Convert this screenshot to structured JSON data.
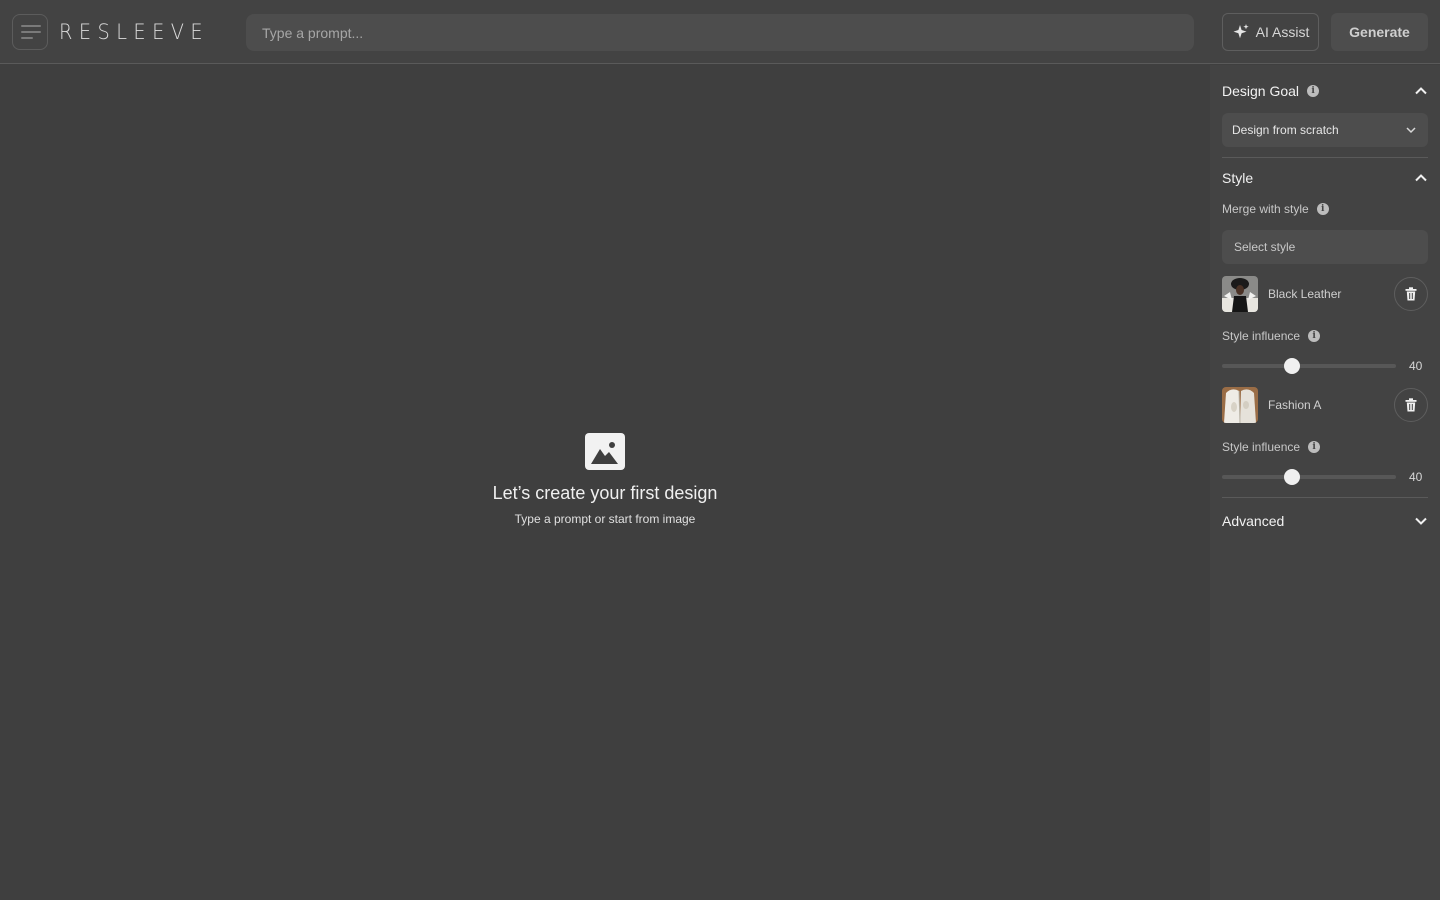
{
  "app": {
    "logo": "RESLEEVE"
  },
  "topbar": {
    "prompt_placeholder": "Type a prompt...",
    "prompt_value": "",
    "ai_assist_label": "AI Assist",
    "generate_label": "Generate"
  },
  "canvas": {
    "empty_title": "Let’s create your first design",
    "empty_subtitle": "Type a prompt or start from image"
  },
  "panel": {
    "design_goal": {
      "title": "Design Goal",
      "selected": "Design from scratch",
      "expanded": true
    },
    "style": {
      "title": "Style",
      "expanded": true,
      "merge_label": "Merge with style",
      "select_placeholder": "Select style",
      "items": [
        {
          "name": "Black Leather",
          "influence_label": "Style influence",
          "influence": 40,
          "influence_max": 100
        },
        {
          "name": "Fashion A",
          "influence_label": "Style influence",
          "influence": 40,
          "influence_max": 100
        }
      ]
    },
    "advanced": {
      "title": "Advanced",
      "expanded": false
    }
  },
  "colors": {
    "background": "#3f3f3f",
    "topbar": "#434343",
    "input": "#4d4d4d",
    "text": "#f0f0f0"
  }
}
